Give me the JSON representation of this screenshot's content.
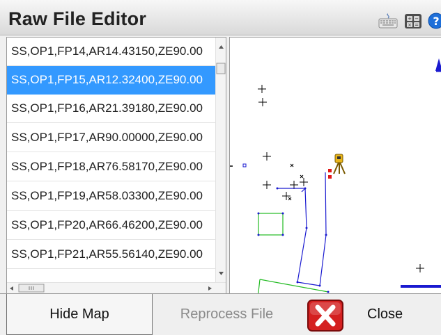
{
  "window": {
    "title": "Raw File Editor",
    "icons": [
      "keyboard-icon",
      "calculator-icon",
      "help-icon"
    ]
  },
  "records": [
    "SS,OP1,FP14,AR14.43150,ZE90.00",
    "SS,OP1,FP15,AR12.32400,ZE90.00",
    "SS,OP1,FP16,AR21.39180,ZE90.00",
    "SS,OP1,FP17,AR90.00000,ZE90.00",
    "SS,OP1,FP18,AR76.58170,ZE90.00",
    "SS,OP1,FP19,AR58.03300,ZE90.00",
    "SS,OP1,FP20,AR66.46200,ZE90.00",
    "SS,OP1,FP21,AR55.56140,ZE90.00"
  ],
  "selected_index": 1,
  "colors": {
    "selection": "#3399ff",
    "traverse_line": "#1a1ad0",
    "boundary_line": "#22bb22",
    "close_icon": "#d42020"
  },
  "buttons": {
    "hide_map": "Hide Map",
    "reprocess": "Reprocess File",
    "close": "Close"
  },
  "button_states": {
    "reprocess_enabled": false
  }
}
